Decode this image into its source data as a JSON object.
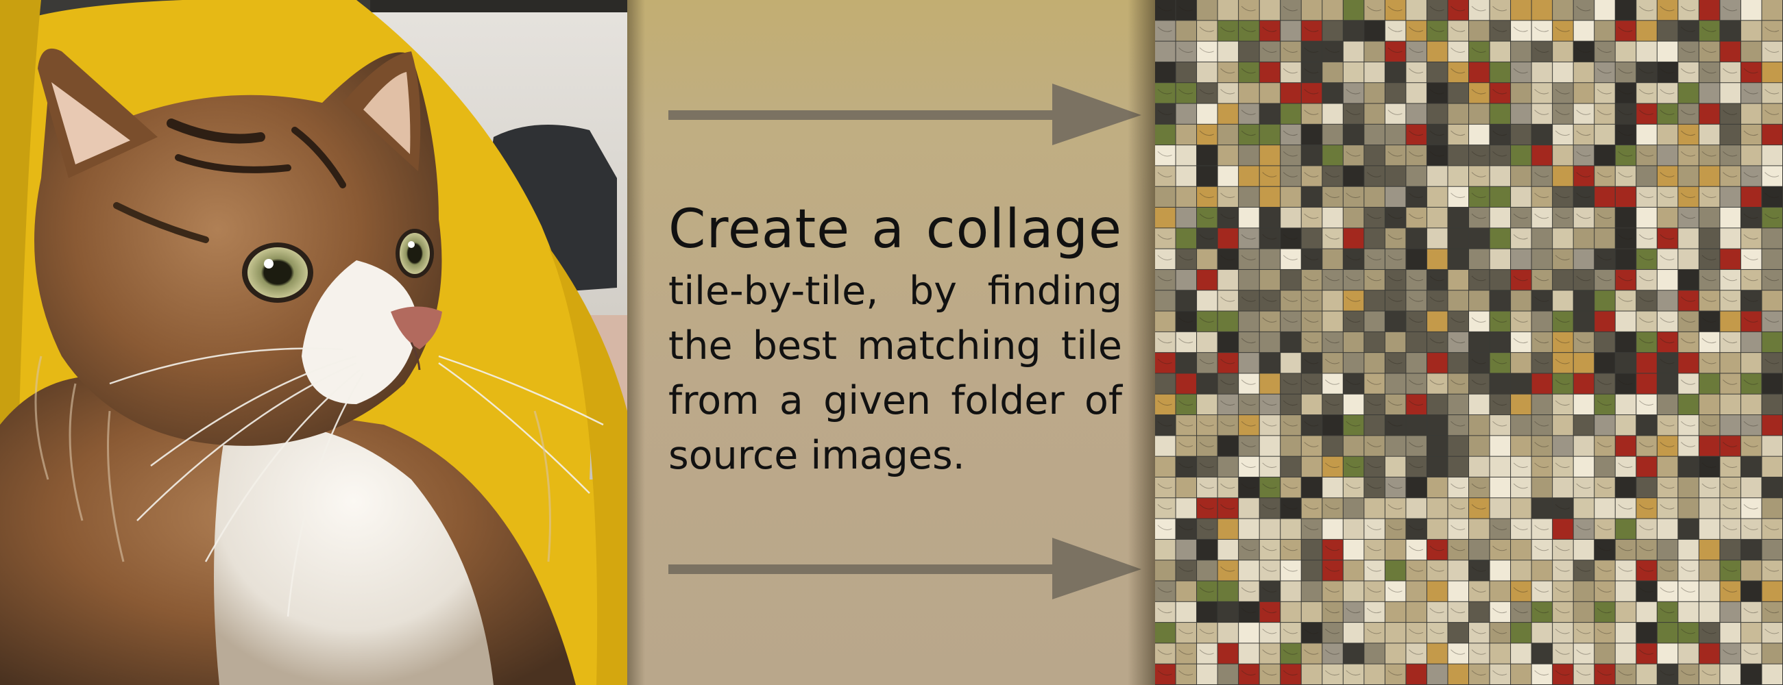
{
  "photo": {
    "subject": "long-haired tabby cat in yellow bag",
    "colors": {
      "bag_yellow": "#e6b915",
      "fur_brown": "#8a5a34",
      "fur_light": "#f0ece6",
      "eye_green": "#8f9460"
    }
  },
  "caption": {
    "headline": "Create a collage",
    "lines": [
      "tile-by-tile, by finding",
      "the best matching tile",
      "from a given folder of",
      "source images."
    ]
  },
  "arrows": {
    "color": "#7b7262",
    "count": 2,
    "direction": "right"
  },
  "mosaic": {
    "description_hidden": true,
    "palette": [
      "#d9cfb5",
      "#c9bb98",
      "#b8a77f",
      "#e4dcc6",
      "#8e8670",
      "#5f5a4c",
      "#3c3a34",
      "#a89a76",
      "#d2c7a8",
      "#f0e9d6",
      "#6b7a3a",
      "#a3281e",
      "#c49a4a",
      "#2e2c28",
      "#9c9586"
    ]
  }
}
